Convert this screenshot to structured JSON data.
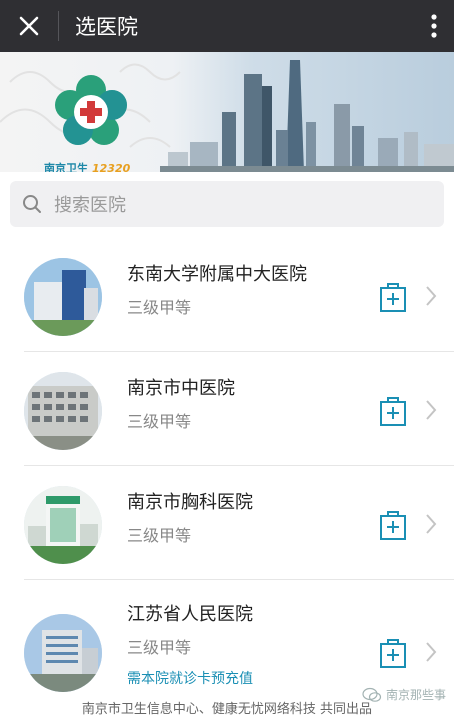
{
  "header": {
    "title": "选医院",
    "close_icon": "close-icon",
    "more_icon": "more-vertical-icon"
  },
  "banner": {
    "logo_text": "南京卫生",
    "logo_number": "12320"
  },
  "search": {
    "placeholder": "搜索医院",
    "icon": "search-icon"
  },
  "hospitals": [
    {
      "name": "东南大学附属中大医院",
      "level": "三级甲等",
      "note": ""
    },
    {
      "name": "南京市中医院",
      "level": "三级甲等",
      "note": ""
    },
    {
      "name": "南京市胸科医院",
      "level": "三级甲等",
      "note": ""
    },
    {
      "name": "江苏省人民医院",
      "level": "三级甲等",
      "note": "需本院就诊卡预充值"
    }
  ],
  "footer": {
    "text": "南京市卫生信息中心、健康无忧网络科技 共同出品"
  },
  "watermark": {
    "text": "南京那些事"
  },
  "colors": {
    "topbar": "#2f2f33",
    "accent": "#1a8fb4",
    "logo_green": "#3aa86a"
  }
}
